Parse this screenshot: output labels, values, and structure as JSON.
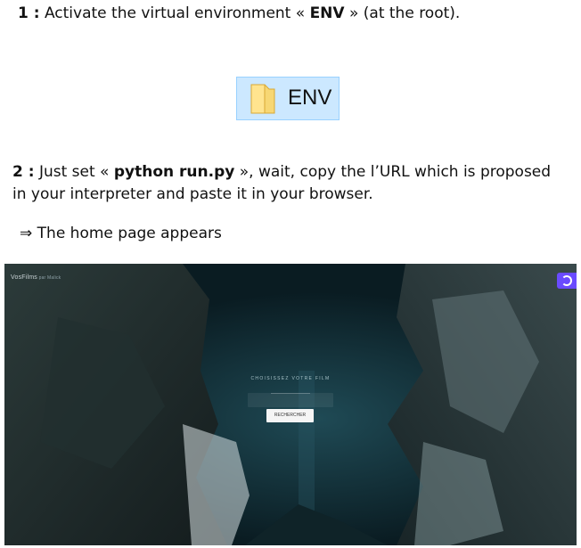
{
  "step1": {
    "number": "1 :",
    "text_before": " Activate the virtual environment « ",
    "env_name": "ENV",
    "text_after": " » (at the root)."
  },
  "folder": {
    "label": "ENV",
    "icon": "folder-icon"
  },
  "step2": {
    "number": "2 :",
    "text_before": " Just set « ",
    "command": "python run.py",
    "text_after": " », wait, copy the l’URL which is proposed in your interpreter and paste it in your browser."
  },
  "result": {
    "arrow": "⇒",
    "text": " The home page appears"
  },
  "app_screenshot": {
    "brand": "VosFilms",
    "brand_by": " par Malick",
    "search_title": "CHOISISSEZ VOTRE FILM",
    "search_input_value": "",
    "search_button": "RECHERCHER",
    "badge_icon": "extension-badge-icon",
    "colors": {
      "background": "#0a1c22",
      "badge": "#6a4bff"
    }
  }
}
